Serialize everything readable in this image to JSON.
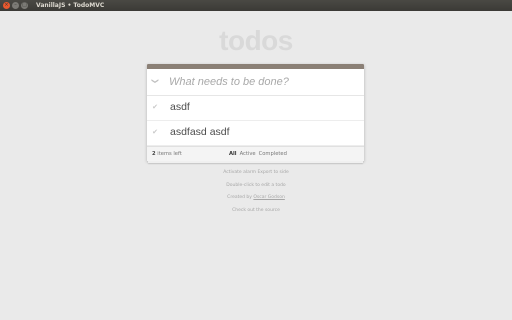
{
  "window": {
    "title": "VanillaJS • TodoMVC",
    "close_glyph": "×",
    "minimize_glyph": "–",
    "maximize_glyph": "□"
  },
  "app": {
    "title": "todos"
  },
  "new_todo": {
    "placeholder": "What needs to be done?",
    "value": ""
  },
  "toggle_all_glyph": "❯",
  "todos": [
    {
      "label": "asdf",
      "completed": false
    },
    {
      "label": "asdfasd asdf",
      "completed": false
    }
  ],
  "check_glyph": "✔",
  "footer": {
    "count": "2",
    "count_suffix": " items left",
    "filters": [
      {
        "label": "All",
        "selected": true
      },
      {
        "label": "Active",
        "selected": false
      },
      {
        "label": "Completed",
        "selected": false
      }
    ]
  },
  "info": {
    "line1": "Activate alarm Export to side",
    "line2": "Double-click to edit a todo",
    "line3_prefix": "Created by ",
    "line3_link": "Oscar Godson",
    "line4": "Check out the source"
  }
}
